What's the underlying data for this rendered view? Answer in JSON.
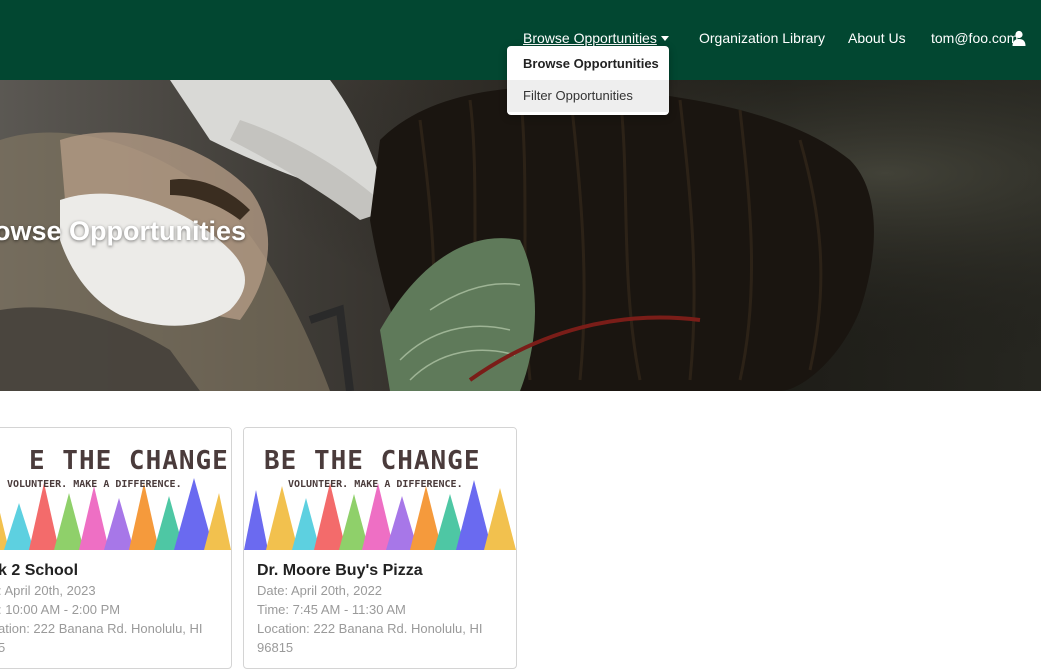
{
  "navbar": {
    "browse_label": "Browse Opportunities",
    "library_label": "Organization Library",
    "about_label": "About Us",
    "user_email": "tom@foo.com",
    "user_icon": "user-icon",
    "background_color": "#024731"
  },
  "dropdown": {
    "items": [
      {
        "label": "Browse Opportunities"
      },
      {
        "label": "Filter Opportunities"
      }
    ]
  },
  "hero": {
    "title": "owse Opportunities"
  },
  "cards": [
    {
      "image_headline": "E THE CHANGE",
      "image_subline": "VOLUNTEER. MAKE A DIFFERENCE.",
      "title": "k 2 School",
      "date": ": April 20th, 2023",
      "time": ": 10:00 AM - 2:00 PM",
      "location": "ation: 222 Banana Rd. Honolulu, HI",
      "location_cont": "5"
    },
    {
      "image_headline": "BE THE CHANGE",
      "image_subline": "VOLUNTEER. MAKE A DIFFERENCE.",
      "title": "Dr. Moore Buy's Pizza",
      "date": "Date: April 20th, 2022",
      "time": "Time: 7:45 AM - 11:30 AM",
      "location": "Location: 222 Banana Rd. Honolulu, HI",
      "location_cont": "96815"
    }
  ]
}
